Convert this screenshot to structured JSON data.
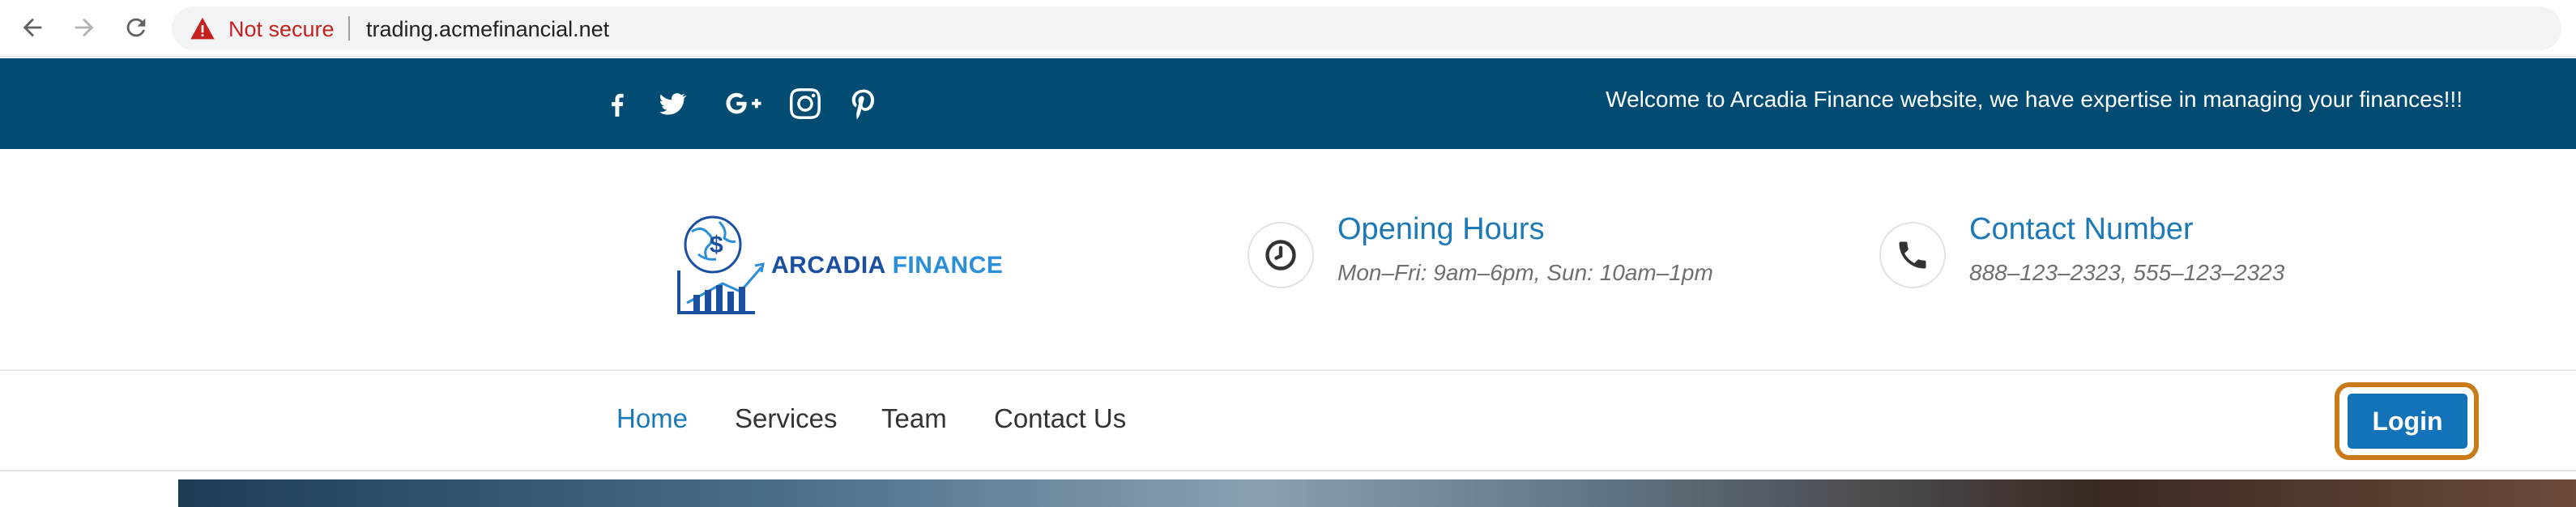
{
  "browser": {
    "security_label": "Not secure",
    "url": "trading.acmefinancial.net"
  },
  "topbar": {
    "social_icons": [
      "facebook-icon",
      "twitter-icon",
      "google-plus-icon",
      "instagram-icon",
      "pinterest-icon"
    ],
    "welcome_text": "Welcome to Arcadia Finance website, we have expertise in managing your finances!!!"
  },
  "header": {
    "logo": {
      "word1": "ARCADIA",
      "word2": "FINANCE"
    },
    "opening_hours": {
      "title": "Opening Hours",
      "text": "Mon–Fri: 9am–6pm, Sun: 10am–1pm"
    },
    "contact": {
      "title": "Contact Number",
      "text": "888–123–2323, 555–123–2323"
    }
  },
  "nav": {
    "items": [
      "Home",
      "Services",
      "Team",
      "Contact Us"
    ],
    "active": "Home",
    "login_label": "Login"
  },
  "colors": {
    "topbar_bg": "#024b73",
    "accent": "#1d78b8",
    "login_bg": "#1473b8",
    "highlight_outline": "#c97a1a"
  }
}
